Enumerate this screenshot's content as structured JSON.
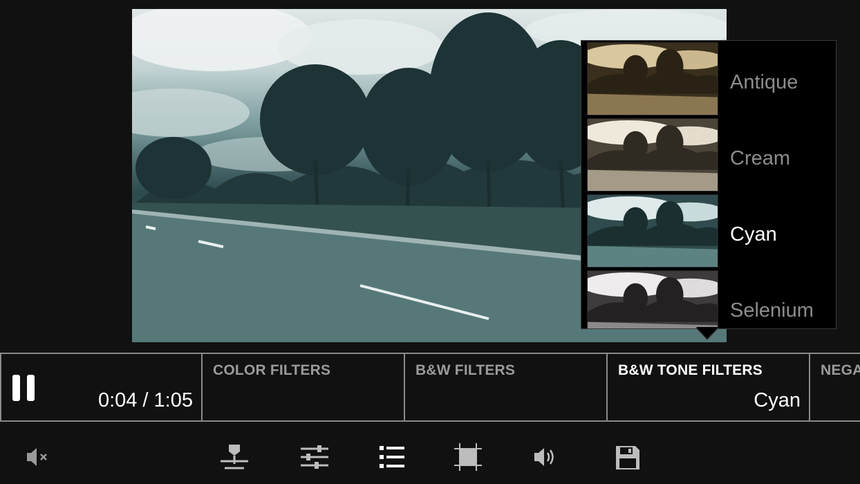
{
  "player": {
    "time": "0:04 / 1:05"
  },
  "popup": {
    "items": [
      {
        "label": "Antique",
        "tint": "#b79f6c"
      },
      {
        "label": "Cream",
        "tint": "#d8cdb6"
      },
      {
        "label": "Cyan",
        "tint": "#8fc5c6",
        "selected": true
      },
      {
        "label": "Selenium",
        "tint": "#c9c4c6"
      }
    ]
  },
  "categories": [
    {
      "title": "COLOR FILTERS",
      "value": ""
    },
    {
      "title": "B&W FILTERS",
      "value": ""
    },
    {
      "title": "B&W TONE FILTERS",
      "value": "Cyan",
      "active": true
    },
    {
      "title": "NEGATIVE",
      "value": ""
    }
  ],
  "toolbar": {
    "icons": [
      "mute-icon",
      "split-icon",
      "adjust-icon",
      "list-icon",
      "crop-icon",
      "volume-icon",
      "save-icon"
    ]
  }
}
